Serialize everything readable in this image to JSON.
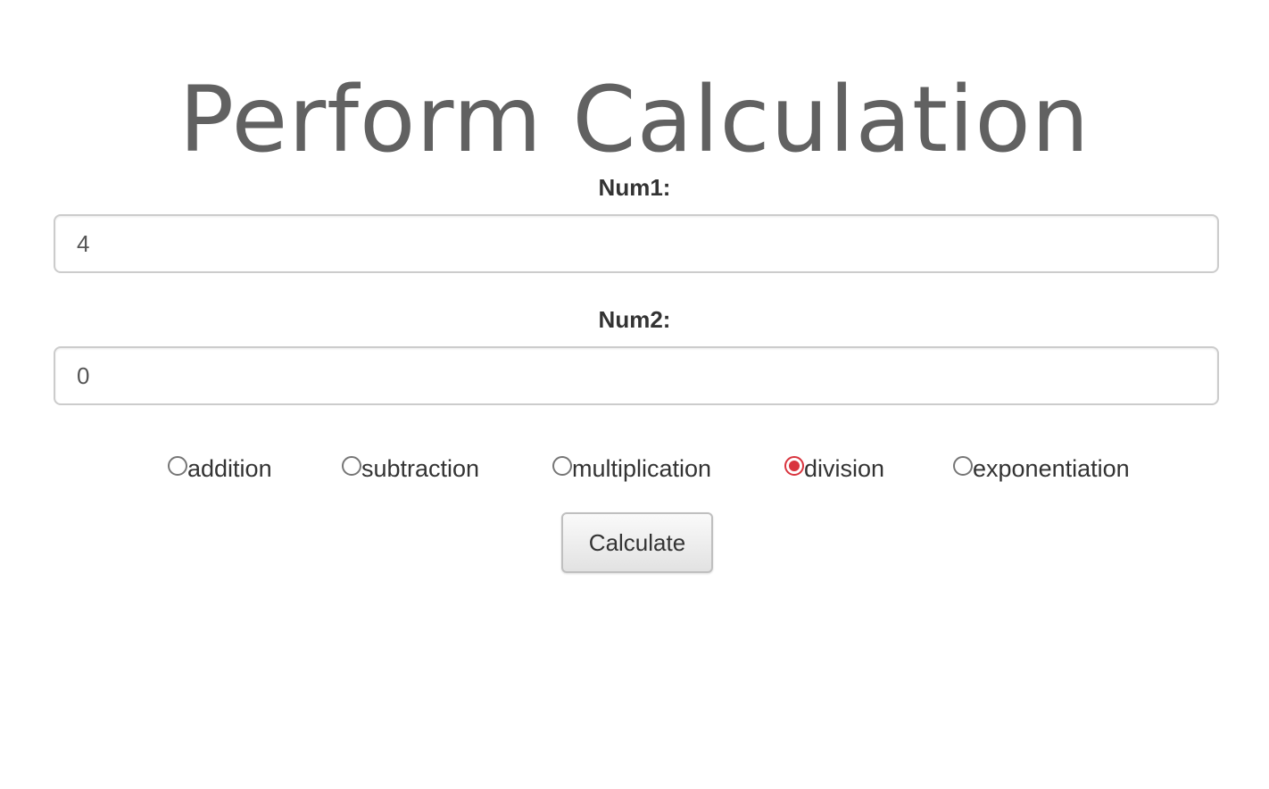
{
  "page": {
    "title": "Perform Calculation"
  },
  "form": {
    "num1_label": "Num1:",
    "num1_value": "4",
    "num2_label": "Num2:",
    "num2_value": "0",
    "operations": [
      {
        "label": "addition",
        "checked": false
      },
      {
        "label": "subtraction",
        "checked": false
      },
      {
        "label": "multiplication",
        "checked": false
      },
      {
        "label": "division",
        "checked": true
      },
      {
        "label": "exponentiation",
        "checked": false
      }
    ],
    "submit_label": "Calculate"
  },
  "colors": {
    "title": "#616161",
    "radio_checked": "#d9343e"
  }
}
